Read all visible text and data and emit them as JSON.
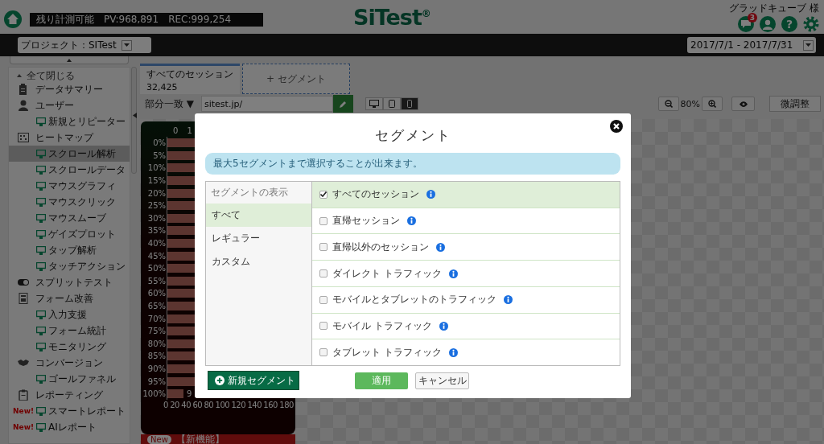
{
  "header": {
    "remaining_label": "残り計測可能",
    "pv": "PV:968,891",
    "rec": "REC:999,254",
    "logo": "SiTest$^{®}$",
    "user_name": "グラッドキューブ 様",
    "notification_count": "3",
    "help_glyph": "?"
  },
  "navbar": {
    "project": "プロジェクト：SITest",
    "date_range": "2017/7/1 - 2017/7/31"
  },
  "sidebar": {
    "collapse_all": "全て閉じる",
    "items": [
      {
        "label": "データサマリー",
        "selected": false
      },
      {
        "label": "ユーザー",
        "selected": false,
        "children": [
          {
            "label": "新規とリピーター",
            "selected": false
          }
        ]
      },
      {
        "label": "ヒートマップ",
        "selected": false,
        "children": [
          {
            "label": "スクロール解析",
            "selected": true
          },
          {
            "label": "スクロールデータ",
            "selected": false
          },
          {
            "label": "マウスグラフィ",
            "selected": false
          },
          {
            "label": "マウスクリック",
            "selected": false
          },
          {
            "label": "マウスムーブ",
            "selected": false
          },
          {
            "label": "ゲイズプロット",
            "selected": false
          },
          {
            "label": "タップ解析",
            "selected": false
          },
          {
            "label": "タッチアクション",
            "selected": false
          }
        ]
      },
      {
        "label": "スプリットテスト",
        "selected": false
      },
      {
        "label": "フォーム改善",
        "selected": false,
        "children": [
          {
            "label": "入力支援",
            "selected": false
          },
          {
            "label": "フォーム統計",
            "selected": false
          },
          {
            "label": "モニタリング",
            "selected": false
          }
        ]
      },
      {
        "label": "コンバージョン",
        "selected": false,
        "children": [
          {
            "label": "ゴールファネル",
            "selected": false
          }
        ]
      },
      {
        "label": "レポーティング",
        "selected": false,
        "children": [
          {
            "label": "スマートレポート",
            "selected": false,
            "badge": "New!"
          },
          {
            "label": "AIレポート",
            "selected": false,
            "badge": "New!"
          }
        ]
      }
    ]
  },
  "segment_tabs": {
    "active": {
      "label": "すべてのセッション",
      "count": "32,425"
    },
    "add_label": "+ セグメント"
  },
  "filter": {
    "match_type": "部分一致 ▼",
    "url": "sitest.jp/"
  },
  "device_buttons": [
    {
      "selected": false
    },
    {
      "selected": false
    },
    {
      "selected": true
    }
  ],
  "zoom": {
    "level_text": "80%",
    "adjust_label": "微調整"
  },
  "scroll_chart": {
    "top_ticks": [
      "0",
      "1"
    ],
    "row_labels": [
      "0%",
      "5%",
      "10%",
      "15%",
      "20%",
      "25%",
      "30%",
      "35%",
      "40%",
      "45%",
      "50%",
      "55%",
      "60%",
      "65%",
      "70%",
      "75%",
      "80%",
      "85%",
      "90%",
      "95%",
      "100%"
    ],
    "point_label": "9",
    "x_ticks": [
      "0",
      "20",
      "40",
      "60",
      "80",
      "100",
      "120",
      "140",
      "160",
      "180"
    ]
  },
  "news": {
    "badge": "New",
    "text": "【新機能】"
  },
  "segment_modal": {
    "title": "セグメント",
    "notice": "最大5セグメントまで選択することが出来ます。",
    "categories_header": "セグメントの表示",
    "categories": [
      {
        "label": "すべて",
        "selected": true
      },
      {
        "label": "レギュラー",
        "selected": false
      },
      {
        "label": "カスタム",
        "selected": false
      }
    ],
    "segments": [
      {
        "label": "すべてのセッション",
        "checked": true
      },
      {
        "label": "直帰セッション",
        "checked": false
      },
      {
        "label": "直帰以外のセッション",
        "checked": false
      },
      {
        "label": "ダイレクト トラフィック",
        "checked": false
      },
      {
        "label": "モバイルとタブレットのトラフィック",
        "checked": false
      },
      {
        "label": "モバイル トラフィック",
        "checked": false
      },
      {
        "label": "タブレット トラフィック",
        "checked": false
      }
    ],
    "buttons": [
      {
        "kind": "new",
        "label": "新規セグメント"
      },
      {
        "kind": "apply",
        "label": "適用"
      },
      {
        "kind": "cancel",
        "label": "キャンセル"
      }
    ]
  }
}
